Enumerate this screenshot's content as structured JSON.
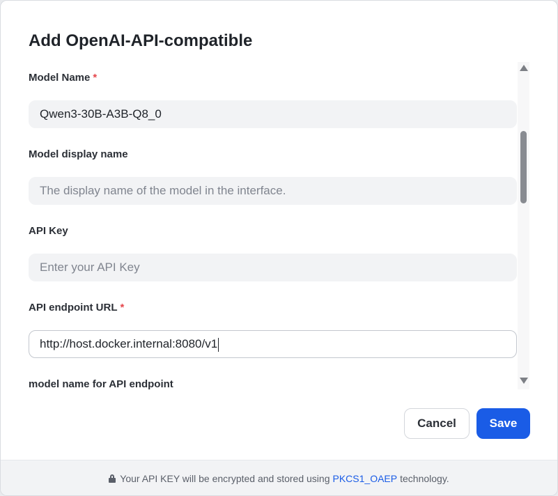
{
  "dialog": {
    "title": "Add OpenAI-API-compatible"
  },
  "fields": {
    "model_name": {
      "label": "Model Name",
      "required_mark": "*",
      "value": "Qwen3-30B-A3B-Q8_0"
    },
    "display_name": {
      "label": "Model display name",
      "placeholder": "The display name of the model in the interface."
    },
    "api_key": {
      "label": "API Key",
      "placeholder": "Enter your API Key"
    },
    "endpoint_url": {
      "label": "API endpoint URL",
      "required_mark": "*",
      "value": "http://host.docker.internal:8080/v1"
    },
    "endpoint_model_name": {
      "label": "model name for API endpoint"
    }
  },
  "buttons": {
    "cancel": "Cancel",
    "save": "Save"
  },
  "footer": {
    "text_before": "Your API KEY will be encrypted and stored using",
    "link": "PKCS1_OAEP",
    "text_after": "technology."
  },
  "icons": {
    "footer": "lock-icon",
    "scroll_up": "arrow-up-icon",
    "scroll_down": "arrow-down-icon"
  },
  "colors": {
    "primary": "#1a5ce6",
    "required": "#e5484d"
  }
}
